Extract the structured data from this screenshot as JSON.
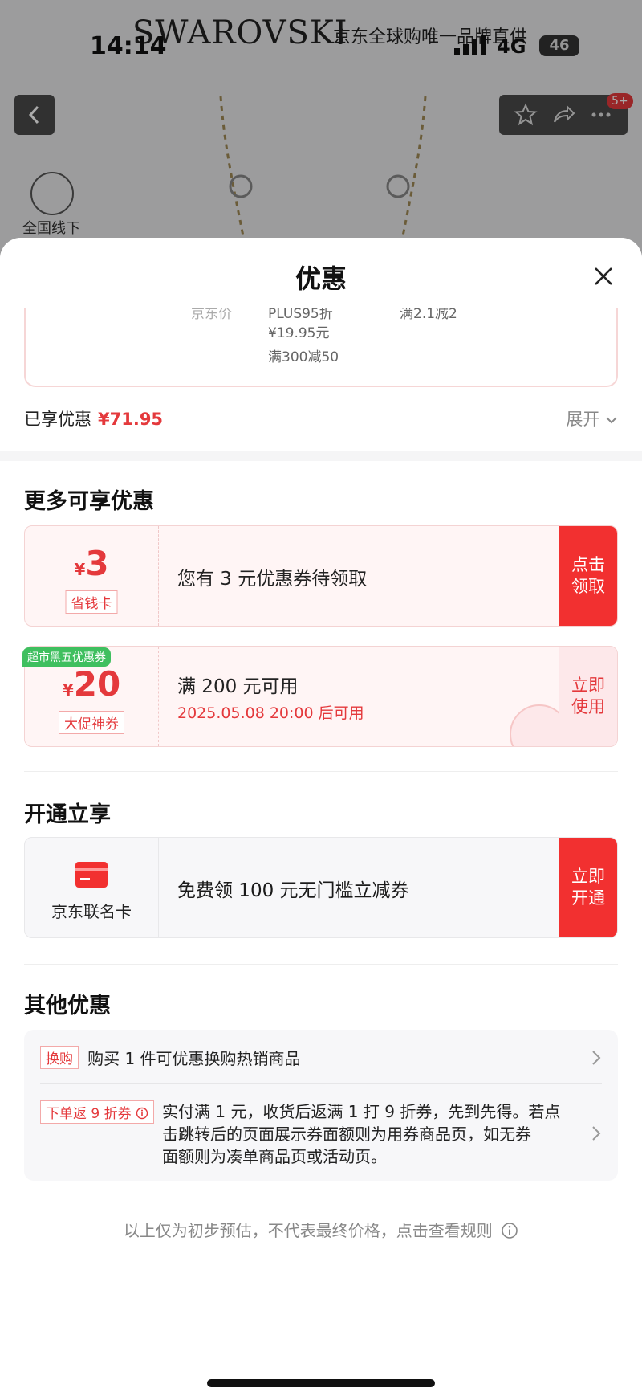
{
  "status_bar": {
    "time": "14:14",
    "network": "4G",
    "battery": "46"
  },
  "background": {
    "brand": "SWAROVSKI",
    "brand_sub": "京东全球购唯一品牌直供",
    "badge": "5+",
    "store_text": "全国线下"
  },
  "sheet": {
    "title": "优惠",
    "price_card": {
      "label": "京东价",
      "plus": "PLUS95折",
      "plus_value": "¥19.95元",
      "full_reduce": "满300减50",
      "manjian": "满2.1减2"
    },
    "saved": {
      "label": "已享优惠",
      "amount": "¥71.95",
      "expand": "展开"
    }
  },
  "more": {
    "title": "更多可享优惠",
    "coupon1": {
      "currency": "¥",
      "amount": "3",
      "tag": "省钱卡",
      "message": "您有 3 元优惠券待领取",
      "action_line1": "点击",
      "action_line2": "领取"
    },
    "coupon2": {
      "ribbon": "超市黑五优惠券",
      "currency": "¥",
      "amount": "20",
      "tag": "大促神券",
      "message": "满 200 元可用",
      "sub": "2025.05.08 20:00 后可用",
      "action_line1": "立即",
      "action_line2": "使用"
    }
  },
  "open": {
    "title": "开通立享",
    "card": {
      "name": "京东联名卡",
      "message": "免费领 100 元无门槛立减券",
      "action_line1": "立即",
      "action_line2": "开通"
    }
  },
  "other": {
    "title": "其他优惠",
    "row1": {
      "tag": "换购",
      "text": "购买 1 件可优惠换购热销商品"
    },
    "row2": {
      "tag": "下单返 9 折券",
      "line1": "实付满 1 元，收货后返满 1 打 9 折券，先到先得。若点",
      "line2": "击跳转后的页面展示券面额则为用券商品页，如无券",
      "line3": "面额则为凑单商品页或活动页。"
    }
  },
  "footer": {
    "note": "以上仅为初步预估，不代表最终价格，点击查看规则"
  },
  "colors": {
    "accent": "#e4393c",
    "button_red": "#f23030",
    "ribbon_green": "#3fbf5f"
  }
}
